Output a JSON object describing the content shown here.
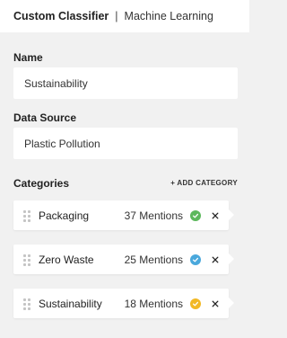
{
  "header": {
    "title": "Custom Classifier",
    "separator": "|",
    "subtitle": "Machine Learning"
  },
  "name_section": {
    "label": "Name",
    "value": "Sustainability"
  },
  "source_section": {
    "label": "Data Source",
    "value": "Plastic Pollution"
  },
  "categories_section": {
    "label": "Categories",
    "add_label": "+ ADD CATEGORY",
    "items": [
      {
        "name": "Packaging",
        "mentions": "37 Mentions",
        "check_color": "#5cb85c",
        "icon": "check-icon"
      },
      {
        "name": "Zero Waste",
        "mentions": "25 Mentions",
        "check_color": "#4aa8dc",
        "icon": "check-icon"
      },
      {
        "name": "Sustainability",
        "mentions": "18 Mentions",
        "check_color": "#f2b824",
        "icon": "check-icon"
      }
    ]
  }
}
